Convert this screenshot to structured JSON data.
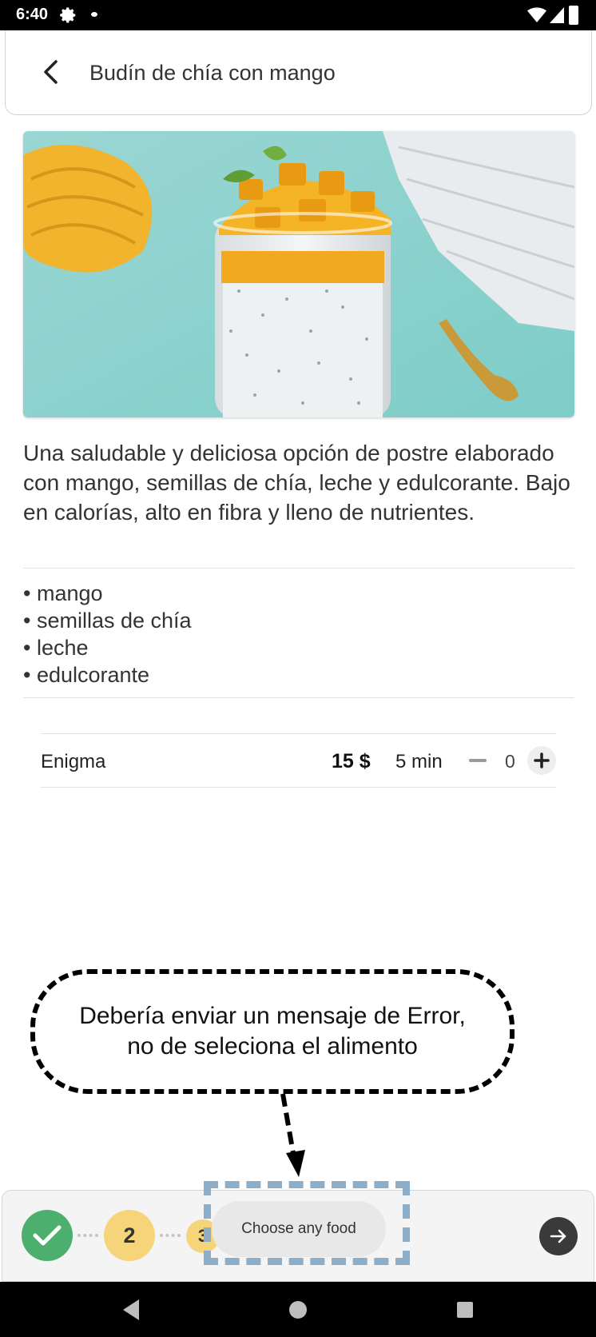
{
  "status_bar": {
    "time": "6:40",
    "icons": [
      "gear-icon",
      "notification-dot-icon",
      "wifi-icon",
      "signal-icon",
      "battery-icon"
    ]
  },
  "header": {
    "back_icon": "chevron-left-icon",
    "title": "Budín de chía con mango"
  },
  "recipe": {
    "description": "Una saludable y deliciosa opción de postre elaborado con mango, semillas de chía, leche y edulcorante. Bajo en calorías, alto en fibra y lleno de nutrientes.",
    "ingredients": [
      "mango",
      "semillas de chía",
      "leche",
      "edulcorante"
    ]
  },
  "options": [
    {
      "name": "Enigma",
      "price": "15 $",
      "time": "5 min",
      "quantity": "0"
    }
  ],
  "annotation": {
    "line1": "Debería enviar un mensaje de Error,",
    "line2": "no de seleciona el alimento"
  },
  "bottom_bar": {
    "steps": [
      {
        "number": "1",
        "state": "done"
      },
      {
        "number": "2",
        "state": "current"
      },
      {
        "number": "3",
        "state": "pending"
      }
    ],
    "toast": "Choose any food",
    "next_icon": "arrow-right-icon"
  },
  "colors": {
    "step_done": "#4caf6e",
    "step_active": "#f5d47a",
    "highlight": "#8eaec7"
  }
}
